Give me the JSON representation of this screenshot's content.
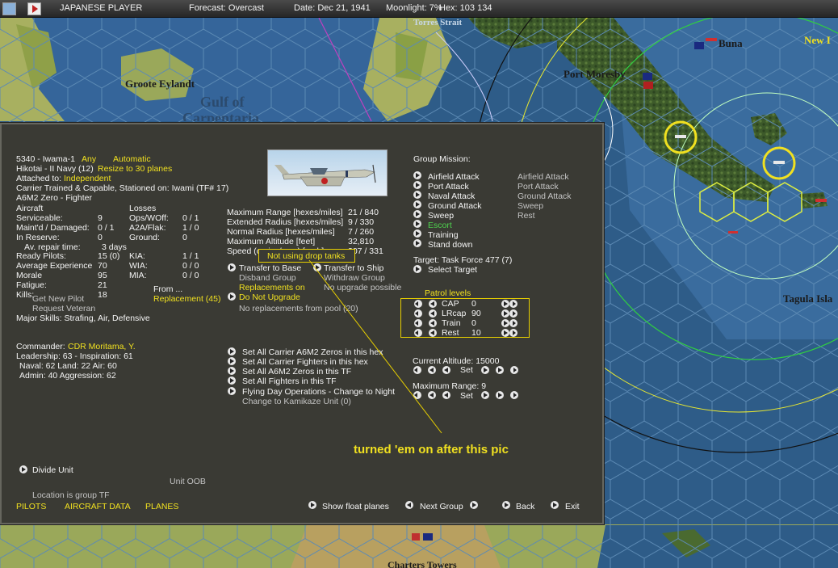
{
  "topbar": {
    "player": "JAPANESE PLAYER",
    "forecast": "Forecast: Overcast",
    "date": "Date: Dec 21, 1941",
    "moonlight": "Moonlight: 7%",
    "hex": "Hex: 103 134"
  },
  "map": {
    "labels": [
      "Groote Eylandt",
      "Gulf of",
      "Carpentaria",
      "Port Moresby",
      "Buna",
      "Tagula Isla",
      "Charters Towers",
      "New I",
      "Torres Strait"
    ]
  },
  "unit": {
    "line1a": "5340 - Iwama-1",
    "line1b": "Any",
    "line1c": "Automatic",
    "line2a": "Hikotai - II Navy (12)",
    "line2b": "Resize to 30 planes",
    "line3a": "Attached to:",
    "line3b": "Independent",
    "line4": "Carrier Trained & Capable, Stationed on: Iwami (TF# 17)",
    "line5": "A6M2 Zero - Fighter"
  },
  "aircraft": {
    "title": "Aircraft",
    "rows": [
      [
        "Serviceable:",
        "9"
      ],
      [
        "Maint'd / Damaged:",
        "0 / 1"
      ],
      [
        "In Reserve:",
        "0"
      ]
    ],
    "repair_label": "Av. repair time:",
    "repair_val": "3 days"
  },
  "losses": {
    "title": "Losses",
    "rows": [
      [
        "Ops/WOff:",
        "0 / 1"
      ],
      [
        "A2A/Flak:",
        "1 / 0"
      ],
      [
        "Ground:",
        "0"
      ]
    ],
    "rows2": [
      [
        "KIA:",
        "1 / 1"
      ],
      [
        "WIA:",
        "0 / 0"
      ],
      [
        "MIA:",
        "0 / 0"
      ]
    ]
  },
  "pilots": {
    "rows": [
      [
        "Ready Pilots:",
        "15 (0)"
      ],
      [
        "Average Experience",
        "70"
      ],
      [
        "Morale",
        "95"
      ],
      [
        "Fatigue:",
        "21"
      ],
      [
        "Kills:",
        "18"
      ]
    ],
    "get_new": "Get New Pilot",
    "request_vet": "Request Veteran",
    "skills": "Major Skills: Strafing, Air, Defensive",
    "from": "From ...",
    "replacement": "Replacement (45)"
  },
  "stats": {
    "rows": [
      [
        "Maximum Range [hexes/miles]",
        "21 / 840"
      ],
      [
        "Extended Radius [hexes/miles]",
        "9 / 330"
      ],
      [
        "Normal Radius [hexes/miles]",
        "7 / 260"
      ],
      [
        "Maximum Altitude [feet]",
        "32,810"
      ],
      [
        "Speed (cruise/max) [mph]",
        "207 / 331"
      ]
    ],
    "drop_tanks": "Not using drop tanks"
  },
  "actions": {
    "transfer_base": "Transfer to Base",
    "transfer_ship": "Transfer to Ship",
    "disband": "Disband Group",
    "withdraw": "Withdraw Group",
    "repl_on": "Replacements on",
    "no_upgrade": "Do Not Upgrade",
    "no_upgrade_possible": "No upgrade possible",
    "no_repl_pool": "No replacements from pool (20)"
  },
  "mission": {
    "title": "Group Mission:",
    "items": [
      "Airfield Attack",
      "Port Attack",
      "Naval Attack",
      "Ground Attack",
      "Sweep",
      "Escort",
      "Training",
      "Stand down"
    ],
    "secondary": [
      "Airfield Attack",
      "Port Attack",
      "Ground Attack",
      "Sweep",
      "Rest"
    ],
    "target": "Target: Task Force 477  (7)",
    "select_target": "Select Target"
  },
  "patrol": {
    "title": "Patrol levels",
    "rows": [
      [
        "CAP",
        "0"
      ],
      [
        "LRcap",
        "90"
      ],
      [
        "Train",
        "0"
      ],
      [
        "Rest",
        "10"
      ]
    ]
  },
  "altitude": {
    "label": "Current Altitude: 15000",
    "set": "Set"
  },
  "maxrange": {
    "label": "Maximum Range: 9",
    "set": "Set"
  },
  "commander": {
    "name_label": "Commander:",
    "name": "CDR Moritama, Y.",
    "leadership": "Leadership: 63 - Inspiration: 61",
    "naval": "Naval: 62  Land: 22  Air: 60",
    "admin": "Admin: 40  Aggression: 62"
  },
  "bulk": {
    "items": [
      "Set All Carrier A6M2 Zeros in this hex",
      "Set All Carrier Fighters in this hex",
      "Set All A6M2 Zeros in this TF",
      "Set All Fighters in this TF",
      "Flying Day Operations - Change to Night"
    ],
    "kamikaze": "Change to Kamikaze Unit (0)"
  },
  "annotation": "turned 'em on after this pic",
  "bottom": {
    "divide": "Divide Unit",
    "oob": "Unit OOB",
    "location": "Location is group TF",
    "tabs": [
      "PILOTS",
      "AIRCRAFT DATA",
      "PLANES"
    ],
    "show_float": "Show float planes",
    "next_group": "Next Group",
    "back": "Back",
    "exit": "Exit"
  }
}
